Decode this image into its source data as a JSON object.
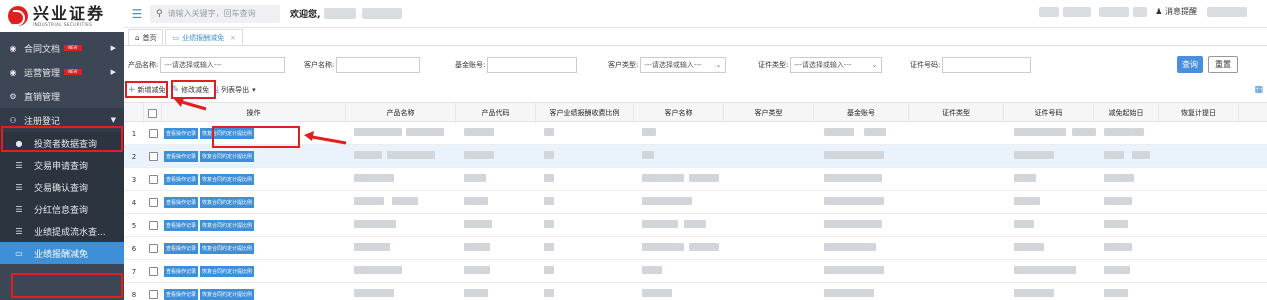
{
  "logo": {
    "cn": "兴业证券",
    "en": "INDUSTRIAL SECURITIES"
  },
  "sidebar": {
    "items": [
      {
        "label": "合同文档",
        "badge": "NEW",
        "icon": "circle-dot-icon"
      },
      {
        "label": "运营管理",
        "badge": "NEW",
        "icon": "circle-dot-icon"
      },
      {
        "label": "直销管理",
        "icon": "gears-icon"
      },
      {
        "label": "注册登记",
        "icon": "user-icon"
      }
    ],
    "sub": [
      {
        "label": "投资者数据查询",
        "icon": "user-circle-icon"
      },
      {
        "label": "交易申请查询",
        "icon": "list-icon"
      },
      {
        "label": "交易确认查询",
        "icon": "list-icon"
      },
      {
        "label": "分红信息查询",
        "icon": "list-icon"
      },
      {
        "label": "业绩提成流水查...",
        "icon": "list-icon"
      },
      {
        "label": "业绩报酬减免",
        "icon": "ticket-icon"
      }
    ]
  },
  "header": {
    "search_placeholder": "请输入关键字，回车查询",
    "welcome": "欢迎您,",
    "notify": "消息提醒"
  },
  "tabs": [
    {
      "label": "首页",
      "icon": "home-icon"
    },
    {
      "label": "业绩报酬减免",
      "icon": "ticket-icon"
    }
  ],
  "filters": {
    "product_name": "产品名称:",
    "product_placeholder": "---请选择或输入---",
    "customer_name": "客户名称:",
    "fund_account": "基金账号:",
    "customer_type": "客户类型:",
    "customer_type_placeholder": "---请选择或输入---",
    "cert_type": "证件类型:",
    "cert_type_placeholder": "---请选择或输入---",
    "cert_no": "证件号码:",
    "query": "查询",
    "reset": "重置"
  },
  "toolbar": {
    "add": "新增减免",
    "edit": "修改减免",
    "export": "列表导出"
  },
  "table": {
    "headers": [
      "操作",
      "产品名称",
      "产品代码",
      "客户业绩报酬收费比例",
      "客户名称",
      "客户类型",
      "基金账号",
      "证件类型",
      "证件号码",
      "减免起始日",
      "恢复计提日"
    ],
    "action_view": "查看操作记录",
    "action_restore": "恢复合同约定计提比例",
    "rows": [
      "1",
      "2",
      "3",
      "4",
      "5",
      "6",
      "7",
      "8"
    ]
  },
  "colors": {
    "accent": "#3d8fd8",
    "annotation": "#e02020",
    "sidebar": "#3c4654"
  }
}
